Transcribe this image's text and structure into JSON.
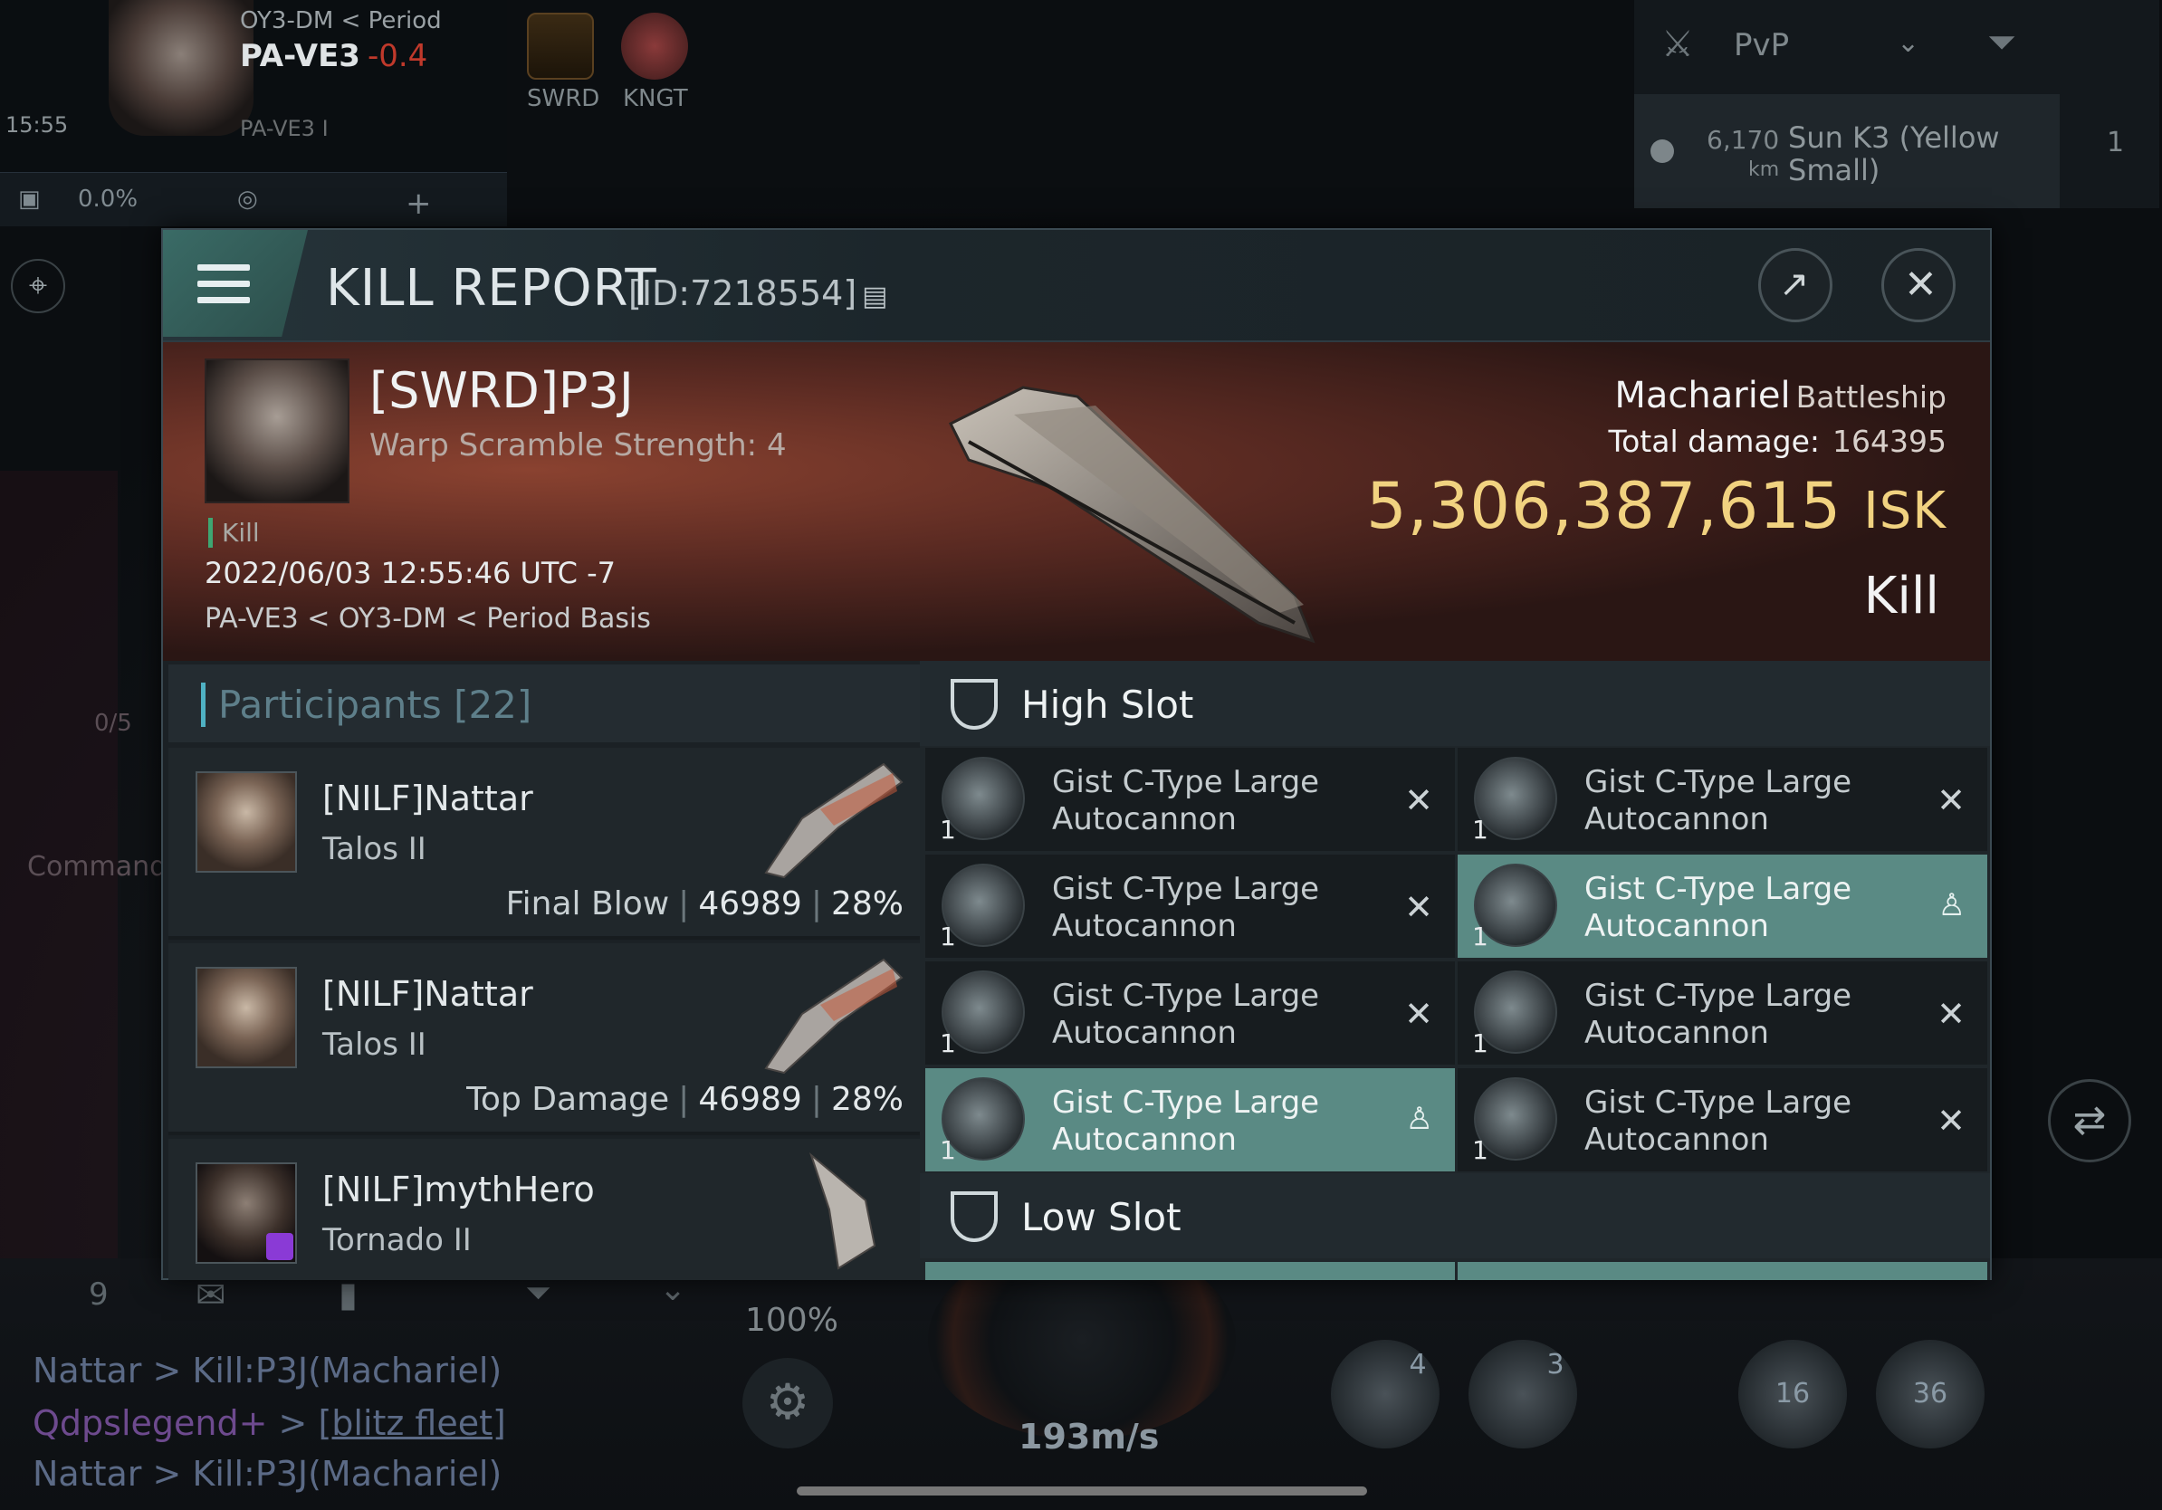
{
  "hud": {
    "region_line": "OY3-DM < Period",
    "system": "PA-VE3",
    "security": "-0.4",
    "location_sub": "PA-VE3 I",
    "clock": "15:55",
    "corp1": "SWRD",
    "corp2": "KNGT",
    "cargo_pct": "0.0%",
    "pvp_filter": "PvP",
    "overview_distance": "6,170",
    "overview_unit": "km",
    "overview_name_1": "Sun K3 (Yellow",
    "overview_name_2": "Small)",
    "overview_count": "1",
    "speed": "193m/s",
    "throttle": "100%",
    "mod_a": "4",
    "mod_b": "3",
    "mod_c": "16",
    "mod_d": "36",
    "cmd_label": "Command",
    "counter": "0/5",
    "mail_count": "9",
    "chat_line_1": "Nattar > Kill:P3J(Machariel)",
    "chat_line_2_name": "Qdpslegend",
    "chat_line_2_link": "[blitz fleet]",
    "chat_line_3": "Nattar > Kill:P3J(Machariel)"
  },
  "window": {
    "title": "KILL REPORT",
    "id": "[ID:7218554]",
    "icons": {
      "menu": "menu-icon",
      "share": "share-icon",
      "close": "close-icon",
      "copy": "copy-icon"
    }
  },
  "victim": {
    "name": "[SWRD]P3J",
    "scramble": "Warp Scramble Strength: 4",
    "tag": "Kill",
    "datetime": "2022/06/03 12:55:46 UTC -7",
    "location": "PA-VE3 < OY3-DM < Period Basis",
    "ship": "Machariel",
    "ship_class": "Battleship",
    "total_damage_label": "Total damage:",
    "total_damage": "164395",
    "isk_value": "5,306,387,615",
    "isk_unit": "ISK",
    "result": "Kill"
  },
  "participants": {
    "title": "Participants",
    "count": "[22]",
    "rows": [
      {
        "name": "[NILF]Nattar",
        "ship": "Talos II",
        "label": "Final Blow",
        "damage": "46989",
        "pct": "28%"
      },
      {
        "name": "[NILF]Nattar",
        "ship": "Talos II",
        "label": "Top Damage",
        "damage": "46989",
        "pct": "28%"
      },
      {
        "name": "[NILF]mythHero",
        "ship": "Tornado II",
        "label": "",
        "damage": "",
        "pct": ""
      }
    ]
  },
  "slots": {
    "high_title": "High Slot",
    "low_title": "Low Slot",
    "items": [
      {
        "name": "Gist C-Type Large Autocannon",
        "qty": "1",
        "status": "destroyed"
      },
      {
        "name": "Gist C-Type Large Autocannon",
        "qty": "1",
        "status": "destroyed"
      },
      {
        "name": "Gist C-Type Large Autocannon",
        "qty": "1",
        "status": "destroyed"
      },
      {
        "name": "Gist C-Type Large Autocannon",
        "qty": "1",
        "status": "dropped"
      },
      {
        "name": "Gist C-Type Large Autocannon",
        "qty": "1",
        "status": "destroyed"
      },
      {
        "name": "Gist C-Type Large Autocannon",
        "qty": "1",
        "status": "destroyed"
      },
      {
        "name": "Gist C-Type Large Autocannon",
        "qty": "1",
        "status": "dropped"
      },
      {
        "name": "Gist C-Type Large Autocannon",
        "qty": "1",
        "status": "destroyed"
      }
    ],
    "destroyed_glyph": "✕",
    "dropped_glyph": "👤"
  },
  "colors": {
    "isk": "#f1d280",
    "dropped": "#5a8a84",
    "accent": "#4fb1c3"
  }
}
